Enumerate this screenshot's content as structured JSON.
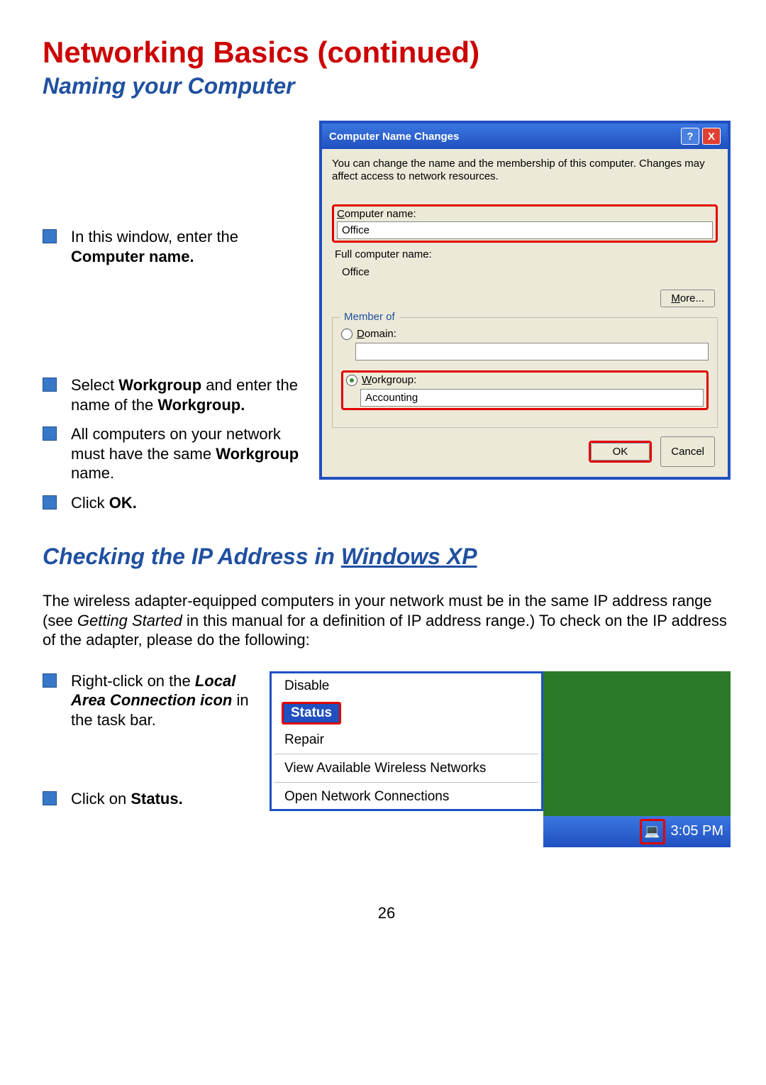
{
  "heading": "Networking Basics (continued)",
  "sub1": "Naming your Computer",
  "bullets1": {
    "b1_pre": "In this window, enter the ",
    "b1_bold": "Computer name.",
    "b2_pre": "Select ",
    "b2_bold1": "Workgroup",
    "b2_mid": " and enter the name of the ",
    "b2_bold2": "Workgroup.",
    "b3_pre": "All computers on your network must have the same ",
    "b3_bold": "Workgroup",
    "b3_post": " name.",
    "b4_pre": "Click ",
    "b4_bold": "OK."
  },
  "dialog": {
    "title": "Computer Name Changes",
    "help": "?",
    "close": "X",
    "intro": "You can change the name and the membership of this computer. Changes may affect access to network resources.",
    "comp_label": "Computer name:",
    "comp_value": "Office",
    "full_label": "Full computer name:",
    "full_value": "Office",
    "more": "More...",
    "member": "Member of",
    "domain": "Domain:",
    "workgroup": "Workgroup:",
    "workgroup_value": "Accounting",
    "ok": "OK",
    "cancel": "Cancel"
  },
  "sub2": "Checking the IP Address in Windows XP",
  "sub2_u": "Windows XP",
  "sub2_pre": "Checking the IP Address in ",
  "para2_a": "The wireless adapter-equipped computers in your network must be in the same IP address range (see ",
  "para2_i": "Getting Started",
  "para2_b": " in this manual for a definition of IP address range.) To check on the IP address of the adapter, please do the following:",
  "bullets2": {
    "b1_pre": "Right-click on the ",
    "b1_bi": "Local Area Connection icon",
    "b1_post": " in the task bar.",
    "b2_pre": "Click on ",
    "b2_bold": "Status."
  },
  "menu": {
    "disable": "Disable",
    "status": "Status",
    "repair": "Repair",
    "view": "View Available Wireless Networks",
    "open": "Open Network Connections"
  },
  "taskbar": {
    "time": "3:05 PM",
    "icon": "💻"
  },
  "page_number": "26"
}
